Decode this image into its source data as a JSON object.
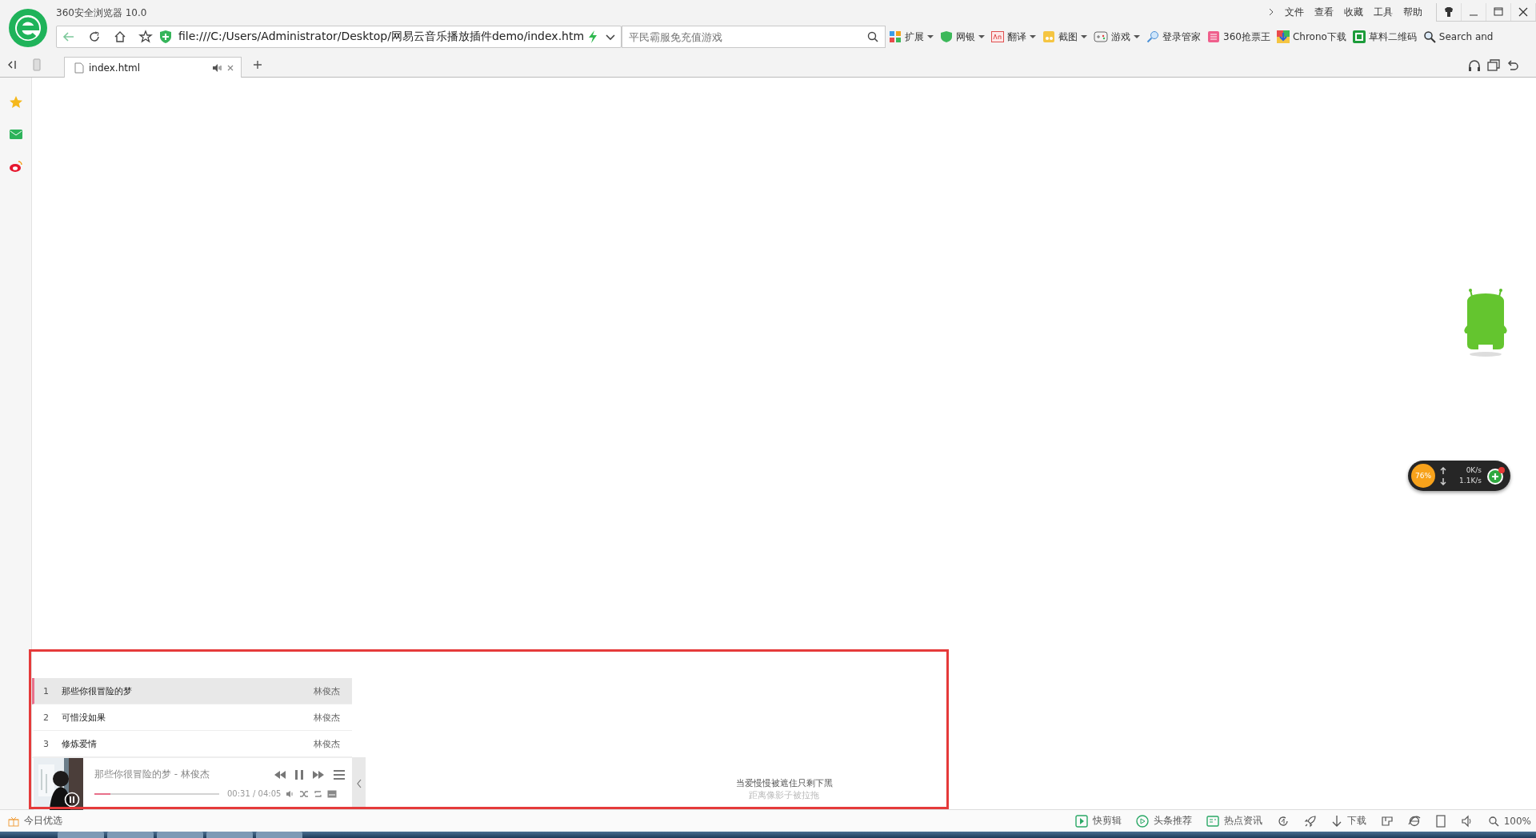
{
  "window": {
    "title": "360安全浏览器 10.0"
  },
  "menu": [
    "文件",
    "查看",
    "收藏",
    "工具",
    "帮助"
  ],
  "nav": {
    "address": "file:///C:/Users/Administrator/Desktop/网易云音乐播放插件demo/index.htm",
    "search_placeholder": "平民霸服免充值游戏"
  },
  "toolbar": [
    {
      "label": "扩展",
      "kind": "grid",
      "dropdown": true
    },
    {
      "label": "网银",
      "kind": "shield",
      "dropdown": true
    },
    {
      "label": "翻译",
      "kind": "translate",
      "dropdown": true
    },
    {
      "label": "截图",
      "kind": "scissors",
      "dropdown": true
    },
    {
      "label": "游戏",
      "kind": "gamepad",
      "dropdown": true
    },
    {
      "label": "登录管家",
      "kind": "key",
      "dropdown": false
    },
    {
      "label": "360抢票王",
      "kind": "ticket",
      "dropdown": false
    },
    {
      "label": "Chrono下载",
      "kind": "download",
      "dropdown": false
    },
    {
      "label": "草料二维码",
      "kind": "qr",
      "dropdown": false
    },
    {
      "label": "Search and",
      "kind": "search",
      "dropdown": false
    }
  ],
  "tabs": [
    {
      "title": "index.html",
      "selected": true
    }
  ],
  "playlist": [
    {
      "index": "1",
      "title": "那些你很冒险的梦",
      "artist": "林俊杰",
      "selected": true
    },
    {
      "index": "2",
      "title": "可惜没如果",
      "artist": "林俊杰",
      "selected": false
    },
    {
      "index": "3",
      "title": "修炼爱情",
      "artist": "林俊杰",
      "selected": false
    }
  ],
  "player": {
    "now_playing": "那些你很冒险的梦 - 林俊杰",
    "level": 0.13,
    "time": "00:31 / 04:05"
  },
  "lyrics": [
    {
      "text": "当爱慢慢被遮住只剩下黑",
      "current": true
    },
    {
      "text": "距离像影子被拉拖",
      "current": false
    }
  ],
  "speed_widget": {
    "percent": "76%",
    "up": "0K/s",
    "down": "1.1K/s"
  },
  "status_bar": {
    "left": "今日优选",
    "items": [
      {
        "kind": "clip",
        "label": "快剪辑"
      },
      {
        "kind": "play",
        "label": "头条推荐"
      },
      {
        "kind": "news",
        "label": "热点资讯"
      },
      {
        "kind": "refresh"
      },
      {
        "kind": "rocket"
      },
      {
        "kind": "download",
        "label": "下载"
      },
      {
        "kind": "layout"
      },
      {
        "kind": "ie"
      },
      {
        "kind": "page"
      },
      {
        "kind": "sound"
      },
      {
        "kind": "zoom",
        "label": "100%"
      }
    ]
  }
}
